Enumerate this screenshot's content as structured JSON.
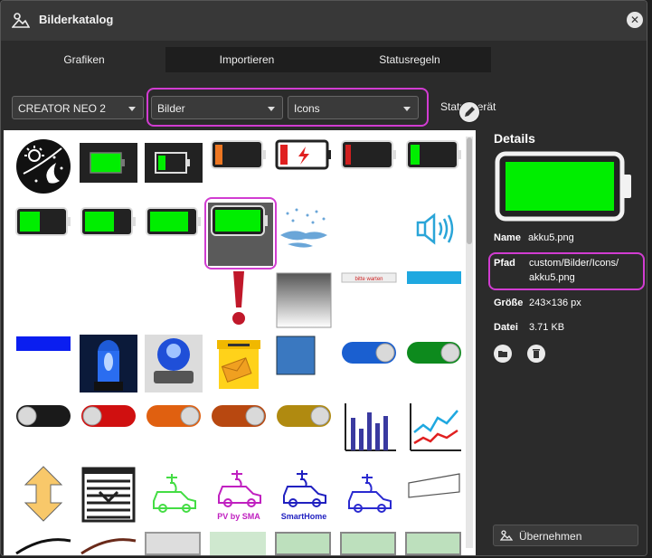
{
  "window": {
    "title": "Bilderkatalog"
  },
  "tabs": [
    {
      "label": "Grafiken"
    },
    {
      "label": "Importieren"
    },
    {
      "label": "Statusregeln"
    }
  ],
  "filters": {
    "device": "CREATOR NEO 2",
    "category": "Bilder",
    "subcategory": "Icons",
    "status_label": "Statusgerät"
  },
  "grid": {
    "tiles": [
      {
        "icon": "day-night-circle-icon"
      },
      {
        "icon": "battery-full-dark-icon"
      },
      {
        "icon": "battery-low-green-icon"
      },
      {
        "icon": "battery-low-orange-icon"
      },
      {
        "icon": "battery-red-lightning-icon"
      },
      {
        "icon": "battery-low-red-icon"
      },
      {
        "icon": "battery-low-green-small-icon"
      },
      {
        "icon": "battery-half-icon"
      },
      {
        "icon": "battery-60-icon"
      },
      {
        "icon": "battery-80-icon"
      },
      {
        "icon": "battery-full-icon"
      },
      {
        "icon": "rain-splash-icon"
      },
      {
        "icon": "blank-tile"
      },
      {
        "icon": "speaker-icon"
      },
      {
        "icon": "blank-tile"
      },
      {
        "icon": "blank-tile"
      },
      {
        "icon": "blank-tile"
      },
      {
        "icon": "exclamation-icon"
      },
      {
        "icon": "gradient-panel-icon"
      },
      {
        "icon": "please-wait-banner-icon",
        "text": "bitte warten"
      },
      {
        "icon": "blue-bar-icon"
      },
      {
        "icon": "blue-rect-icon"
      },
      {
        "icon": "blue-siren-icon"
      },
      {
        "icon": "blue-siren-2-icon"
      },
      {
        "icon": "mailbox-icon"
      },
      {
        "icon": "blue-square-icon"
      },
      {
        "icon": "toggle-blue-icon"
      },
      {
        "icon": "toggle-green-icon"
      },
      {
        "icon": "toggle-black-icon"
      },
      {
        "icon": "toggle-red-icon"
      },
      {
        "icon": "toggle-orange-icon"
      },
      {
        "icon": "toggle-brown-icon"
      },
      {
        "icon": "toggle-yellow-icon"
      },
      {
        "icon": "bar-chart-icon"
      },
      {
        "icon": "line-chart-icon"
      },
      {
        "icon": "arrow-updown-icon"
      },
      {
        "icon": "shutter-icon"
      },
      {
        "icon": "ev-car-green-icon"
      },
      {
        "icon": "ev-car-pv-icon",
        "text": "PV by SMA"
      },
      {
        "icon": "ev-car-smarthome-icon",
        "text": "SmartHome"
      },
      {
        "icon": "ev-car-blue-icon"
      },
      {
        "icon": "window-shape-icon"
      }
    ]
  },
  "details": {
    "heading": "Details",
    "name_label": "Name",
    "name_value": "akku5.png",
    "path_label": "Pfad",
    "path_line1": "custom/Bilder/Icons/",
    "path_line2": "akku5.png",
    "size_label": "Größe",
    "size_value": "243×136 px",
    "file_label": "Datei",
    "file_value": "3.71 KB",
    "apply_label": "Übernehmen"
  },
  "colors": {
    "accent": "#d13cd1",
    "battery_green": "#00ee00"
  }
}
